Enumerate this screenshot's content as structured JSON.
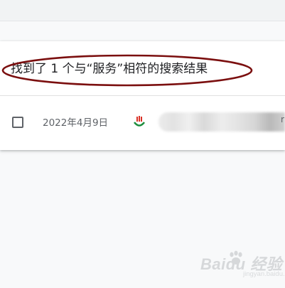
{
  "results": {
    "summary": "找到了 1 个与“服务”相符的搜索结果",
    "highlight_color": "#7b0f0f"
  },
  "rows": [
    {
      "date": "2022年4月9日",
      "cut_char": "r"
    }
  ],
  "watermark": {
    "text": "Baidu 经验",
    "sub": "jingyan.baidu.com"
  }
}
